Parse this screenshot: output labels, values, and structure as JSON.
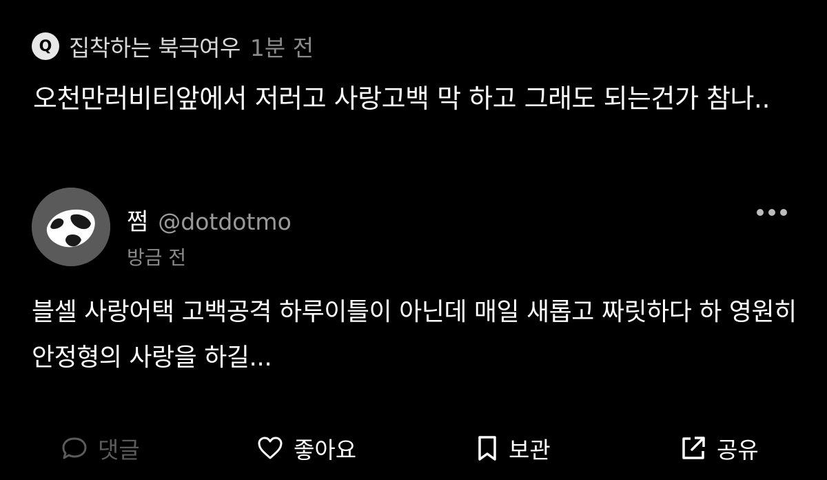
{
  "quoted": {
    "badge": "Q",
    "author": "집착하는 북극여우",
    "time": "1분 전",
    "text": "오천만러비티앞에서 저러고 사랑고백 막 하고 그래도 되는건가 참나.."
  },
  "post": {
    "display_name": "쩜",
    "handle": "@dotdotmo",
    "time": "방금 전",
    "text": "블셀 사랑어택 고백공격 하루이틀이 아닌데 매일 새롭고 짜릿하다 하 영원히 안정형의 사랑을 하길..."
  },
  "actions": {
    "comment_label": "댓글",
    "like_label": "좋아요",
    "save_label": "보관",
    "share_label": "공유"
  },
  "colors": {
    "background": "#000000",
    "primary_text": "#ffffff",
    "secondary_text": "#8a8a8a",
    "disabled_action": "#5b5b5b"
  },
  "icons": [
    "more-icon",
    "comment-icon",
    "heart-icon",
    "bookmark-icon",
    "share-icon"
  ]
}
